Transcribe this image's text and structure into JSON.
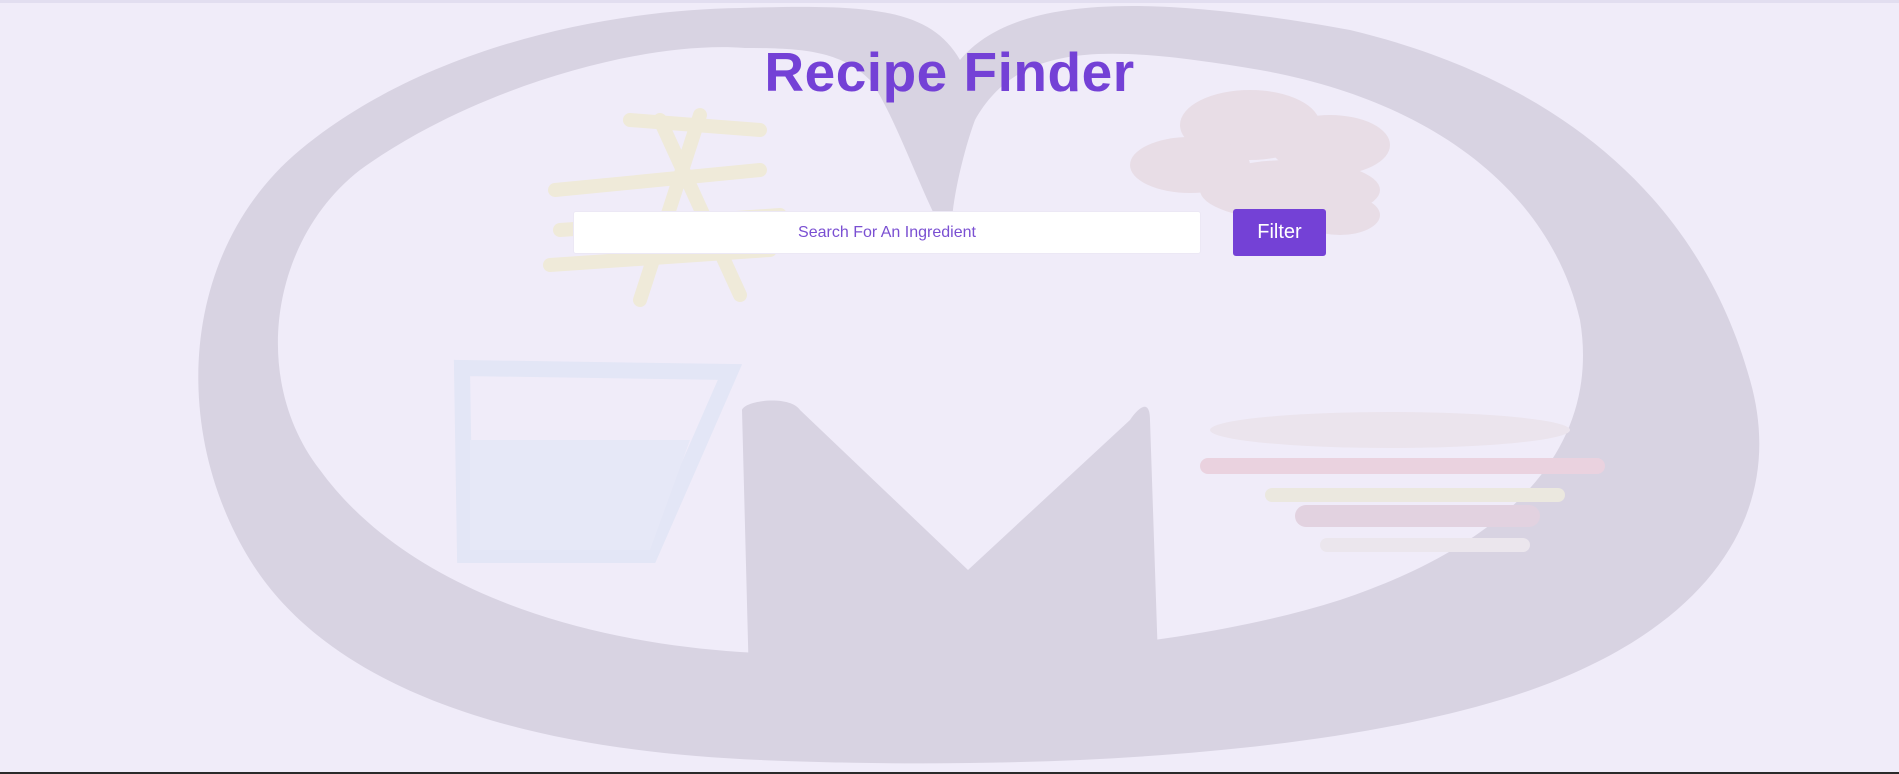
{
  "app": {
    "title": "Recipe Finder"
  },
  "search": {
    "placeholder": "Search For An Ingredient",
    "value": ""
  },
  "filter": {
    "label": "Filter"
  },
  "colors": {
    "accent": "#7441d6",
    "background": "#f0ecf9",
    "logo_watermark": "#d8d3e2"
  },
  "background_logo": {
    "icon": "recipe-finder-logo-watermark"
  }
}
